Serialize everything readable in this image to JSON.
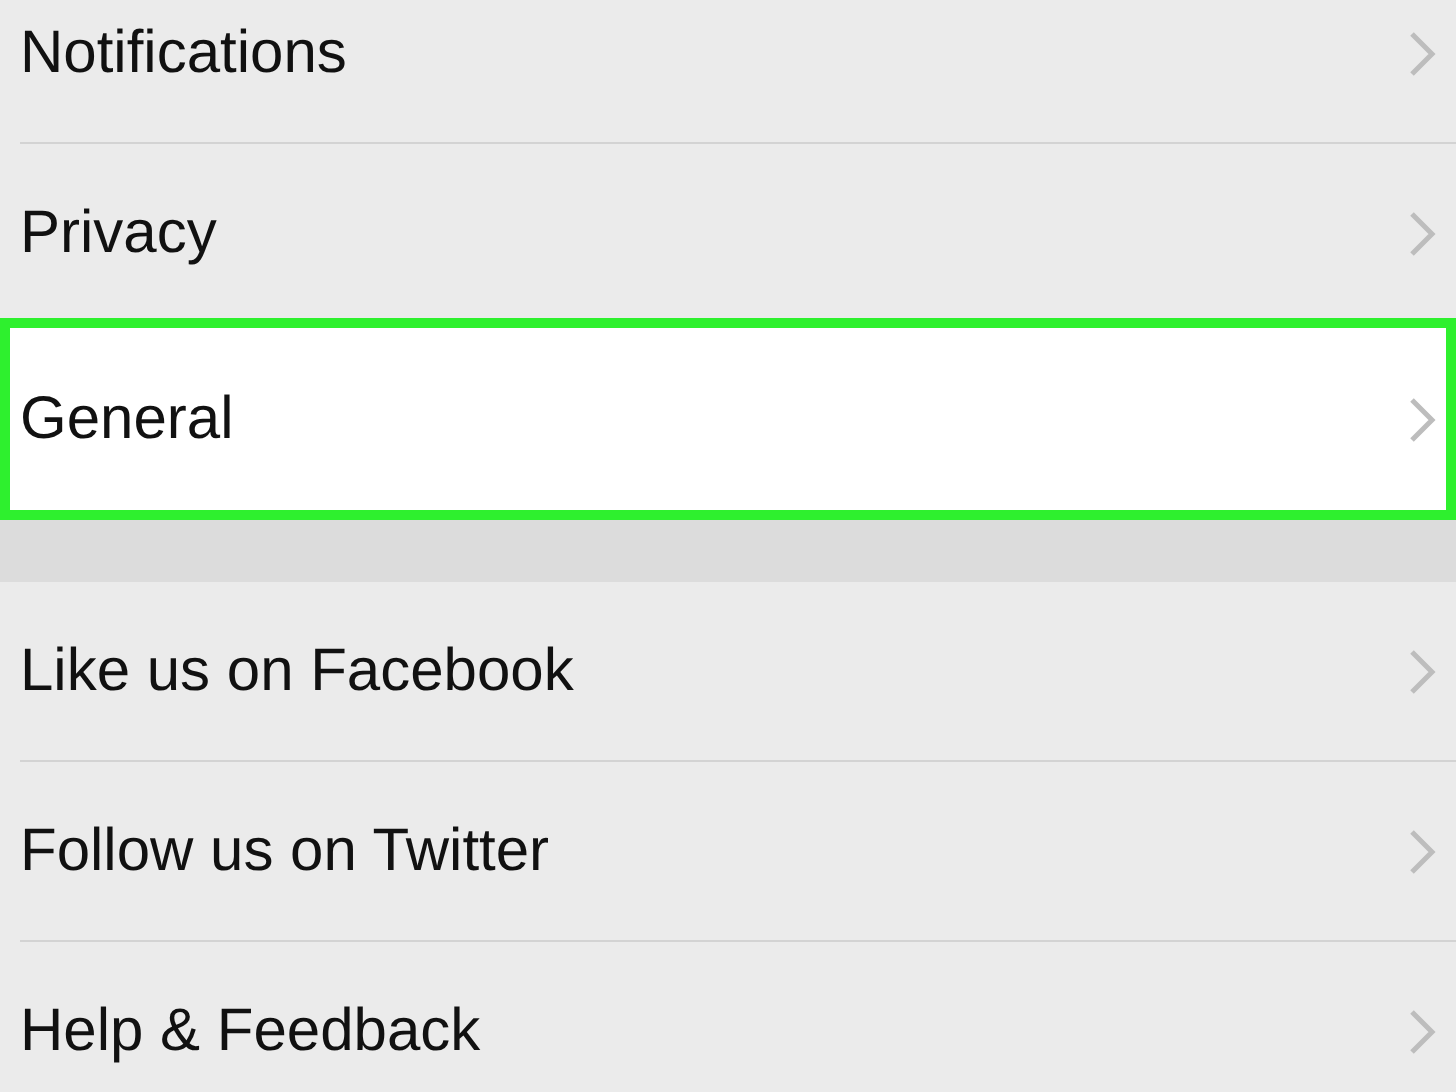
{
  "sections": [
    {
      "rows": [
        {
          "label": "Notifications",
          "highlighted": false
        },
        {
          "label": "Privacy",
          "highlighted": false
        },
        {
          "label": "General",
          "highlighted": true
        }
      ]
    },
    {
      "rows": [
        {
          "label": "Like us on Facebook",
          "highlighted": false
        },
        {
          "label": "Follow us on Twitter",
          "highlighted": false
        },
        {
          "label": "Help & Feedback",
          "highlighted": false
        }
      ]
    }
  ]
}
